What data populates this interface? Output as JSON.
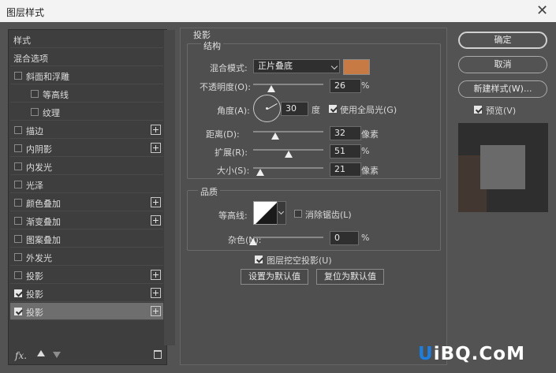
{
  "window": {
    "title": "图层样式",
    "close_glyph": "✕"
  },
  "styles_panel": {
    "items": [
      {
        "label": "样式",
        "checkbox": false,
        "checked": false,
        "plus": false,
        "selected": false,
        "indent": 0
      },
      {
        "label": "混合选项",
        "checkbox": false,
        "checked": false,
        "plus": false,
        "selected": false,
        "indent": 0
      },
      {
        "label": "斜面和浮雕",
        "checkbox": true,
        "checked": false,
        "plus": false,
        "selected": false,
        "indent": 0
      },
      {
        "label": "等高线",
        "checkbox": true,
        "checked": false,
        "plus": false,
        "selected": false,
        "indent": 1
      },
      {
        "label": "纹理",
        "checkbox": true,
        "checked": false,
        "plus": false,
        "selected": false,
        "indent": 1
      },
      {
        "label": "描边",
        "checkbox": true,
        "checked": false,
        "plus": true,
        "selected": false,
        "indent": 0
      },
      {
        "label": "内阴影",
        "checkbox": true,
        "checked": false,
        "plus": true,
        "selected": false,
        "indent": 0
      },
      {
        "label": "内发光",
        "checkbox": true,
        "checked": false,
        "plus": false,
        "selected": false,
        "indent": 0
      },
      {
        "label": "光泽",
        "checkbox": true,
        "checked": false,
        "plus": false,
        "selected": false,
        "indent": 0
      },
      {
        "label": "颜色叠加",
        "checkbox": true,
        "checked": false,
        "plus": true,
        "selected": false,
        "indent": 0
      },
      {
        "label": "渐变叠加",
        "checkbox": true,
        "checked": false,
        "plus": true,
        "selected": false,
        "indent": 0
      },
      {
        "label": "图案叠加",
        "checkbox": true,
        "checked": false,
        "plus": false,
        "selected": false,
        "indent": 0
      },
      {
        "label": "外发光",
        "checkbox": true,
        "checked": false,
        "plus": false,
        "selected": false,
        "indent": 0
      },
      {
        "label": "投影",
        "checkbox": true,
        "checked": false,
        "plus": true,
        "selected": false,
        "indent": 0
      },
      {
        "label": "投影",
        "checkbox": true,
        "checked": true,
        "plus": true,
        "selected": false,
        "indent": 0
      },
      {
        "label": "投影",
        "checkbox": true,
        "checked": true,
        "plus": true,
        "selected": true,
        "indent": 0
      }
    ],
    "footer": {
      "fx_label": "fx."
    }
  },
  "drop_shadow": {
    "section_title": "投影",
    "structure": {
      "title": "结构",
      "blend_mode_label": "混合模式:",
      "blend_mode_value": "正片叠底",
      "color": "#c87a45",
      "opacity_label": "不透明度(O):",
      "opacity_value": "26",
      "opacity_unit": "%",
      "opacity_level": 0.26,
      "angle_label": "角度(A):",
      "angle_value": "30",
      "angle_unit": "度",
      "global_light_label": "使用全局光(G)",
      "global_light_checked": true,
      "distance_label": "距离(D):",
      "distance_value": "32",
      "distance_unit": "像素",
      "distance_level": 0.32,
      "spread_label": "扩展(R):",
      "spread_value": "51",
      "spread_unit": "%",
      "spread_level": 0.51,
      "size_label": "大小(S):",
      "size_value": "21",
      "size_unit": "像素",
      "size_level": 0.1
    },
    "quality": {
      "title": "品质",
      "contour_label": "等高线:",
      "antialias_label": "消除锯齿(L)",
      "antialias_checked": false,
      "noise_label": "杂色(N):",
      "noise_value": "0",
      "noise_unit": "%",
      "noise_level": 0
    },
    "knockout_label": "图层挖空投影(U)",
    "knockout_checked": true,
    "set_default_label": "设置为默认值",
    "reset_default_label": "复位为默认值"
  },
  "actions": {
    "ok_label": "确定",
    "cancel_label": "取消",
    "new_style_label": "新建样式(W)...",
    "preview_label": "预览(V)",
    "preview_checked": true
  },
  "watermark": {
    "part1": "U",
    "part2": "iBQ.CoM"
  }
}
